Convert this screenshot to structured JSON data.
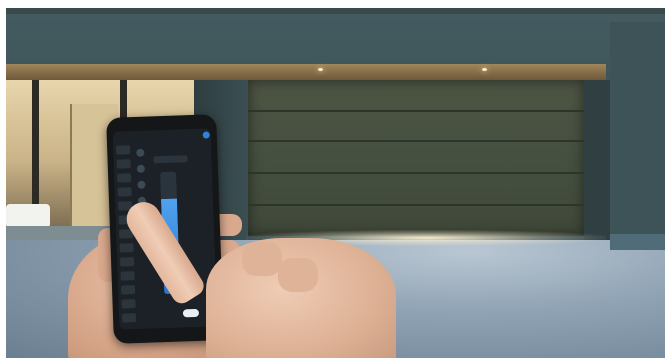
{
  "phone": {
    "app_title": "",
    "readout": "",
    "slider_level": 0.78,
    "slider_label": "",
    "ok_label": ""
  },
  "colors": {
    "wall": "#3a4e52",
    "garage_door": "#465040",
    "driveway": "#90a3b4",
    "slider_accent": "#2f83d8"
  }
}
